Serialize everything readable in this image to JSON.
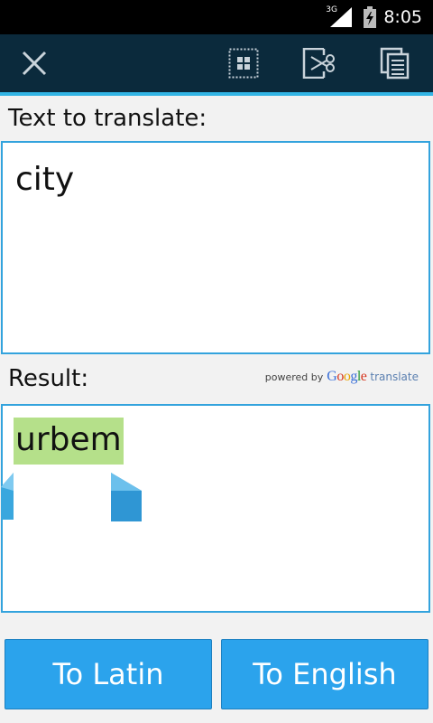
{
  "status_bar": {
    "network": "3G",
    "time": "8:05"
  },
  "action_bar": {
    "icons": [
      "close-icon",
      "select-all-icon",
      "cut-icon",
      "copy-icon"
    ]
  },
  "input": {
    "label": "Text to translate:",
    "value": "city"
  },
  "result": {
    "label": "Result:",
    "value": "urbem",
    "powered_by": "powered by",
    "provider": "Google",
    "provider_suffix": "translate"
  },
  "buttons": {
    "to_latin": "To Latin",
    "to_english": "To English"
  },
  "colors": {
    "accent": "#33b5e5",
    "action_bar": "#0b2a3c",
    "button": "#2ba3ec",
    "selection": "#b5e08a"
  }
}
